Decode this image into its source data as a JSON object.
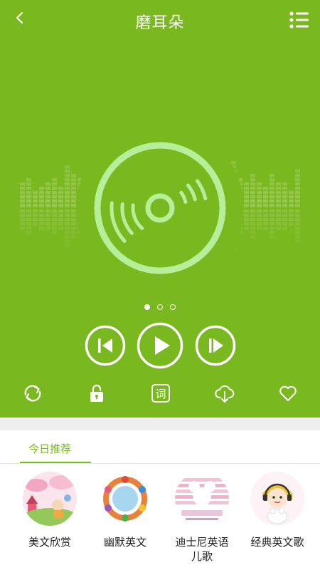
{
  "header": {
    "title": "磨耳朵"
  },
  "pager": {
    "count": 3,
    "active_index": 0
  },
  "actions": {
    "repeat": "repeat-icon",
    "lock": "lock-icon",
    "lyrics_label": "词",
    "download": "cloud-download-icon",
    "favorite": "heart-icon"
  },
  "tab": {
    "label": "今日推荐"
  },
  "recommendations": [
    {
      "label": "美文欣赏"
    },
    {
      "label": "幽默英文"
    },
    {
      "label": "迪士尼英语儿歌"
    },
    {
      "label": "经典英文歌"
    }
  ],
  "colors": {
    "accent": "#7ab81f",
    "band": "#eeeeee"
  }
}
